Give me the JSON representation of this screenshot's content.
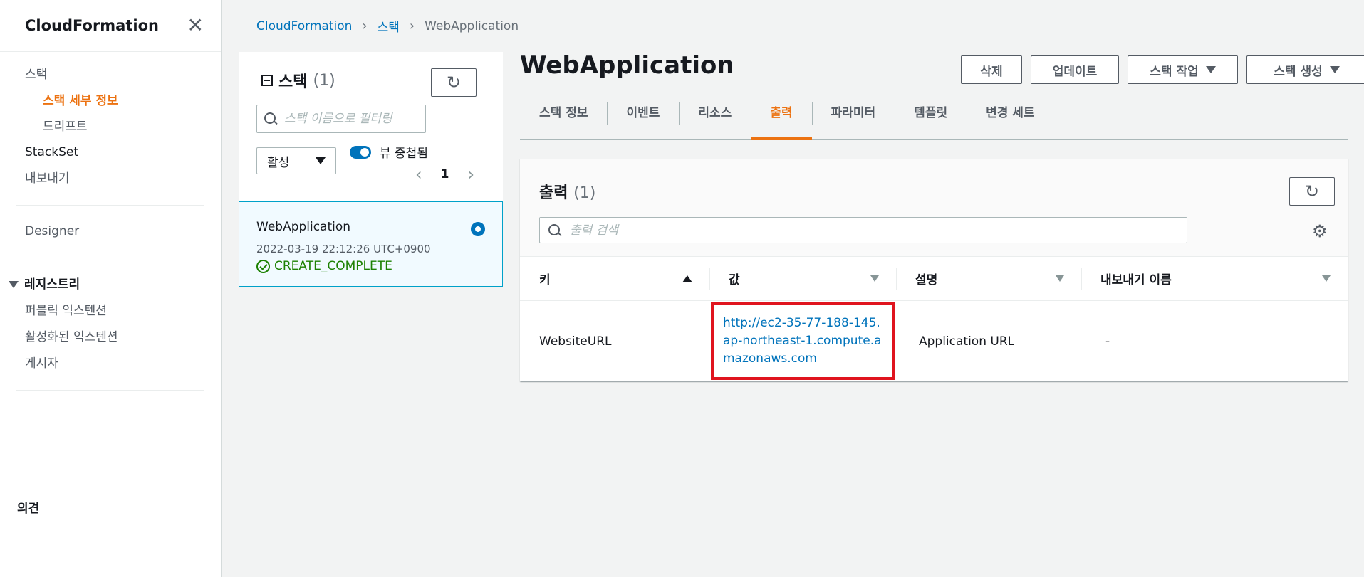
{
  "sidebar": {
    "title": "CloudFormation",
    "items": {
      "stacks": "스택",
      "stack_details": "스택 세부 정보",
      "drift": "드리프트",
      "stackset": "StackSet",
      "exports": "내보내기",
      "designer": "Designer"
    },
    "registry": {
      "title": "레지스트리",
      "public_extensions": "퍼블릭 익스텐션",
      "activated_extensions": "활성화된 익스텐션",
      "publisher": "게시자"
    },
    "feedback": "의견"
  },
  "breadcrumb": {
    "root": "CloudFormation",
    "stacks": "스택",
    "current": "WebApplication"
  },
  "stack_panel": {
    "title": "스택",
    "count": "(1)",
    "search_placeholder": "스택 이름으로 필터링",
    "filter_value": "활성",
    "toggle_label": "뷰 중첩됨",
    "page": "1",
    "stacks": [
      {
        "name": "WebApplication",
        "date": "2022-03-19 22:12:26 UTC+0900",
        "status": "CREATE_COMPLETE"
      }
    ]
  },
  "main": {
    "title": "WebApplication",
    "actions": {
      "delete": "삭제",
      "update": "업데이트",
      "stack_actions": "스택 작업",
      "create_stack": "스택 생성"
    },
    "tabs": [
      "스택 정보",
      "이벤트",
      "리소스",
      "출력",
      "파라미터",
      "템플릿",
      "변경 세트"
    ],
    "active_tab": "출력"
  },
  "outputs": {
    "title": "출력",
    "count": "(1)",
    "search_placeholder": "출력 검색",
    "columns": [
      "키",
      "값",
      "설명",
      "내보내기 이름"
    ],
    "rows": [
      {
        "key": "WebsiteURL",
        "value": "http://ec2-35-77-188-145.ap-northeast-1.compute.amazonaws.com",
        "description": "Application URL",
        "export_name": "-"
      }
    ]
  },
  "colors": {
    "accent_orange": "#ec7211",
    "link_blue": "#0073bb",
    "success_green": "#1d8102",
    "highlight_red": "#e0141e"
  }
}
